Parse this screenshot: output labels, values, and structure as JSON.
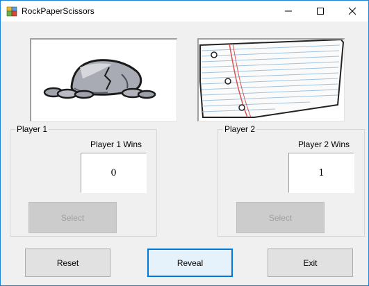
{
  "window": {
    "title": "RockPaperScissors"
  },
  "player1": {
    "legend": "Player 1",
    "wins_label": "Player 1 Wins",
    "score": "0",
    "select_label": "Select",
    "image": "rock-image"
  },
  "player2": {
    "legend": "Player 2",
    "wins_label": "Player 2 Wins",
    "score": "1",
    "select_label": "Select",
    "image": "paper-image"
  },
  "buttons": {
    "reset": "Reset",
    "reveal": "Reveal",
    "exit": "Exit"
  },
  "colors": {
    "accent": "#0078d7",
    "window_border": "#1883d7",
    "background": "#f0f0f0"
  }
}
